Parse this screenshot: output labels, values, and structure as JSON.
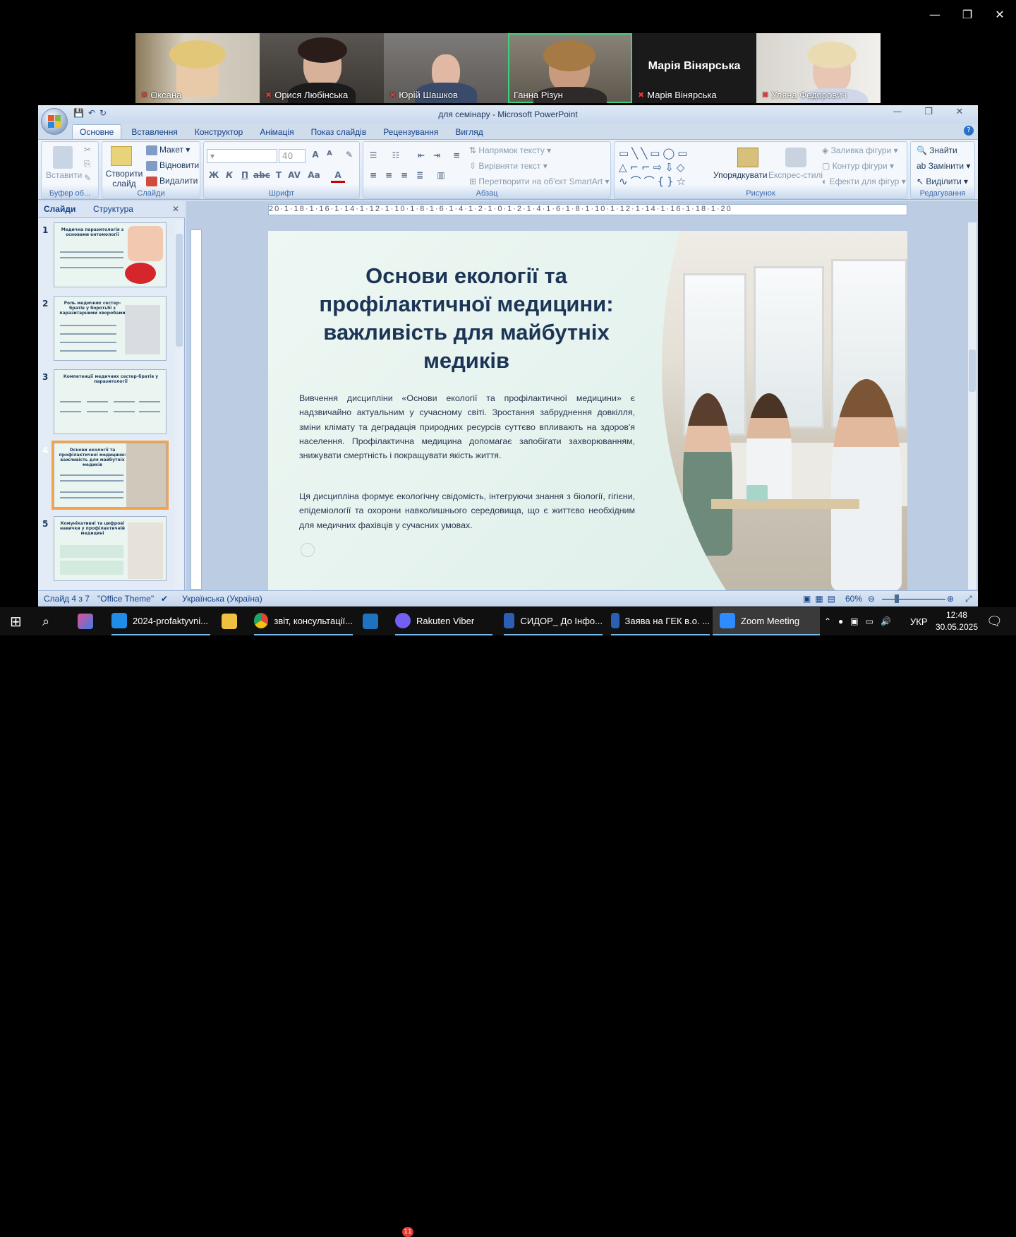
{
  "zoom": {
    "window_controls": {
      "minimize": "—",
      "restore": "❐",
      "close": "✕"
    },
    "participants": [
      {
        "name": "Оксана",
        "muted": true,
        "active": false
      },
      {
        "name": "Орися Любінська",
        "muted": true,
        "active": false
      },
      {
        "name": "Юрій Шашков",
        "muted": true,
        "active": false
      },
      {
        "name": "Ганна Різун",
        "muted": false,
        "active": true
      },
      {
        "name": "Марія Вінярська",
        "muted": true,
        "active": false,
        "big_label": "Марія Вінярська"
      },
      {
        "name": "Уляна Федорович",
        "muted": true,
        "active": false
      }
    ]
  },
  "powerpoint": {
    "window_title": "для семінару - Microsoft PowerPoint",
    "tabs": [
      "Основне",
      "Вставлення",
      "Конструктор",
      "Анімація",
      "Показ слайдів",
      "Рецензування",
      "Вигляд"
    ],
    "active_tab": "Основне",
    "ribbon": {
      "clipboard": {
        "label": "Буфер об...",
        "paste": "Вставити"
      },
      "slides": {
        "label": "Слайди",
        "new_slide": "Створити слайд",
        "layout": "Макет",
        "reset": "Відновити",
        "delete": "Видалити"
      },
      "font": {
        "label": "Шрифт",
        "size": "40"
      },
      "paragraph": {
        "label": "Абзац",
        "text_direction": "Напрямок тексту",
        "align_text": "Вирівняти текст",
        "smartart": "Перетворити на об'єкт SmartArt"
      },
      "drawing": {
        "label": "Рисунок",
        "arrange": "Упорядкувати",
        "quick_styles": "Експрес-стилі",
        "shape_fill": "Заливка фігури",
        "shape_outline": "Контур фігури",
        "shape_effects": "Ефекти для фігур"
      },
      "editing": {
        "label": "Редагування",
        "find": "Знайти",
        "replace": "Замінити",
        "select": "Виділити"
      }
    },
    "pane": {
      "tab_slides": "Слайди",
      "tab_outline": "Структура",
      "thumbnails": [
        {
          "number": "1",
          "title": "Медична паразитологія з основами ентомології"
        },
        {
          "number": "2",
          "title": "Роль медичних сестер-братів у боротьбі з паразитарними хворобами"
        },
        {
          "number": "3",
          "title": "Компетенції медичних сестер-братів у паразитології"
        },
        {
          "number": "4",
          "title": "Основи екології та профілактичної медицини: важливість для майбутніх медиків"
        },
        {
          "number": "5",
          "title": "Комунікативні та цифрові навички у профілактичній медицині"
        }
      ],
      "selected": "4"
    },
    "ruler_text": "20·1·18·1·16·1·14·1·12·1·10·1·8·1·6·1·4·1·2·1·0·1·2·1·4·1·6·1·8·1·10·1·12·1·14·1·16·1·18·1·20",
    "slide": {
      "title": "Основи екології та профілактичної медицини: важливість для майбутніх медиків",
      "paragraph1": "Вивчення дисципліни «Основи екології та профілактичної медицини» є надзвичайно актуальним у сучасному світі. Зростання забруднення довкілля, зміни клімату та деградація природних ресурсів суттєво впливають на здоров'я населення. Профілактична медицина допомагає запобігати захворюванням, знижувати смертність і покращувати якість життя.",
      "paragraph2": "Ця дисципліна формує екологічну свідомість, інтегруючи знання з біології, гігієни, епідеміології та охорони навколишнього середовища, що є життєво необхідним для медичних фахівців у сучасних умовах."
    },
    "status": {
      "slide_counter": "Слайд 4 з 7",
      "theme": "\"Office Theme\"",
      "language": "Українська (Україна)",
      "zoom_level": "60%"
    }
  },
  "taskbar": {
    "items": [
      {
        "label": "2024-profaktyvni...",
        "color": "#1f8ce6"
      },
      {
        "label": "",
        "color": "#f0c040"
      },
      {
        "label": "звіт, консультації...",
        "color": "#e0463b"
      },
      {
        "label": "",
        "color": "#1e73be"
      },
      {
        "label": "Rakuten Viber",
        "color": "#7360f2",
        "badge": "11"
      },
      {
        "label": "СИДОР_ До Інфо...",
        "color": "#2b5fb4"
      },
      {
        "label": "Заява на ГЕК в.о. ...",
        "color": "#2b5fb4"
      },
      {
        "label": "Zoom Meeting",
        "color": "#2d8cff"
      }
    ],
    "language": "УКР",
    "time": "12:48",
    "date": "30.05.2025",
    "notifications": "1"
  }
}
